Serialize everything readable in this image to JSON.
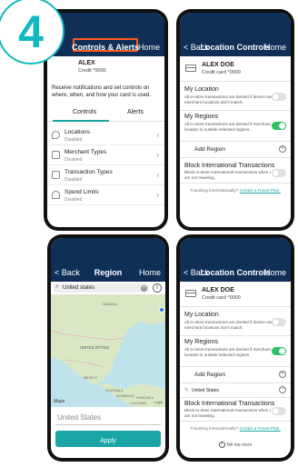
{
  "step_number": "4",
  "colors": {
    "navy": "#0f2f57",
    "teal": "#1aa6a6",
    "toggle_on": "#2ac35f",
    "highlight": "#ff5a1f"
  },
  "phone1": {
    "title": "Controls & Alerts",
    "home": "Home",
    "card_name": "ALEX",
    "card_sub": "Credit *0000",
    "intro": "Receive notifications and set controls on where, when, and how your card is used.",
    "tabs": [
      "Controls",
      "Alerts"
    ],
    "items": [
      {
        "label": "Locations",
        "status": "Disabled",
        "icon": "location-pin-icon"
      },
      {
        "label": "Merchant Types",
        "status": "Disabled",
        "icon": "store-icon"
      },
      {
        "label": "Transaction Types",
        "status": "Disabled",
        "icon": "receipt-icon"
      },
      {
        "label": "Spend Limits",
        "status": "Disabled",
        "icon": "gauge-icon"
      }
    ]
  },
  "phone2": {
    "back": "< Back",
    "title": "Location Controls",
    "home": "Home",
    "card_name": "ALEX DOE",
    "card_sub": "Credit card *0000",
    "my_location_title": "My Location",
    "my_location_desc": "All in-store transactions are denied if device and merchant locations don't match.",
    "my_location_on": false,
    "my_regions_title": "My Regions",
    "my_regions_desc": "All in-store transactions are denied if merchant location is outside selected regions.",
    "my_regions_on": true,
    "add_region": "Add Region",
    "block_title": "Block International Transactions",
    "block_desc": "Block in-store international transactions when I am not traveling.",
    "block_on": false,
    "travel_text": "Traveling internationally?",
    "travel_link": "Create a Travel Plan."
  },
  "phone3": {
    "back": "< Back",
    "title": "Region",
    "home": "Home",
    "search_value": "United states",
    "map_labels": [
      "CANADA",
      "UNITED STATES",
      "MEXICO",
      "GUATEMALA",
      "NICARAGUA",
      "VENEZUELA",
      "COLOMBIA"
    ],
    "maps_brand": "Maps",
    "legal": "Legal",
    "region_name": "United States",
    "apply": "Apply"
  },
  "phone4": {
    "back": "< Back",
    "title": "Location Controls",
    "home": "Home",
    "card_name": "ALEX DOE",
    "card_sub": "Credit card *0000",
    "my_location_title": "My Location",
    "my_location_desc": "All in-store transactions are denied if device and merchant locations don't match.",
    "my_location_on": false,
    "my_regions_title": "My Regions",
    "my_regions_desc": "All in-store transactions are denied if merchant location is outside selected regions.",
    "my_regions_on": true,
    "add_region": "Add Region",
    "selected_region": "United States",
    "block_title": "Block International Transactions",
    "block_desc": "Block in-store international transactions when I am not traveling.",
    "block_on": false,
    "travel_text": "Traveling internationally?",
    "travel_link": "Create a Travel Plan.",
    "tell_more": "Tell me more"
  }
}
